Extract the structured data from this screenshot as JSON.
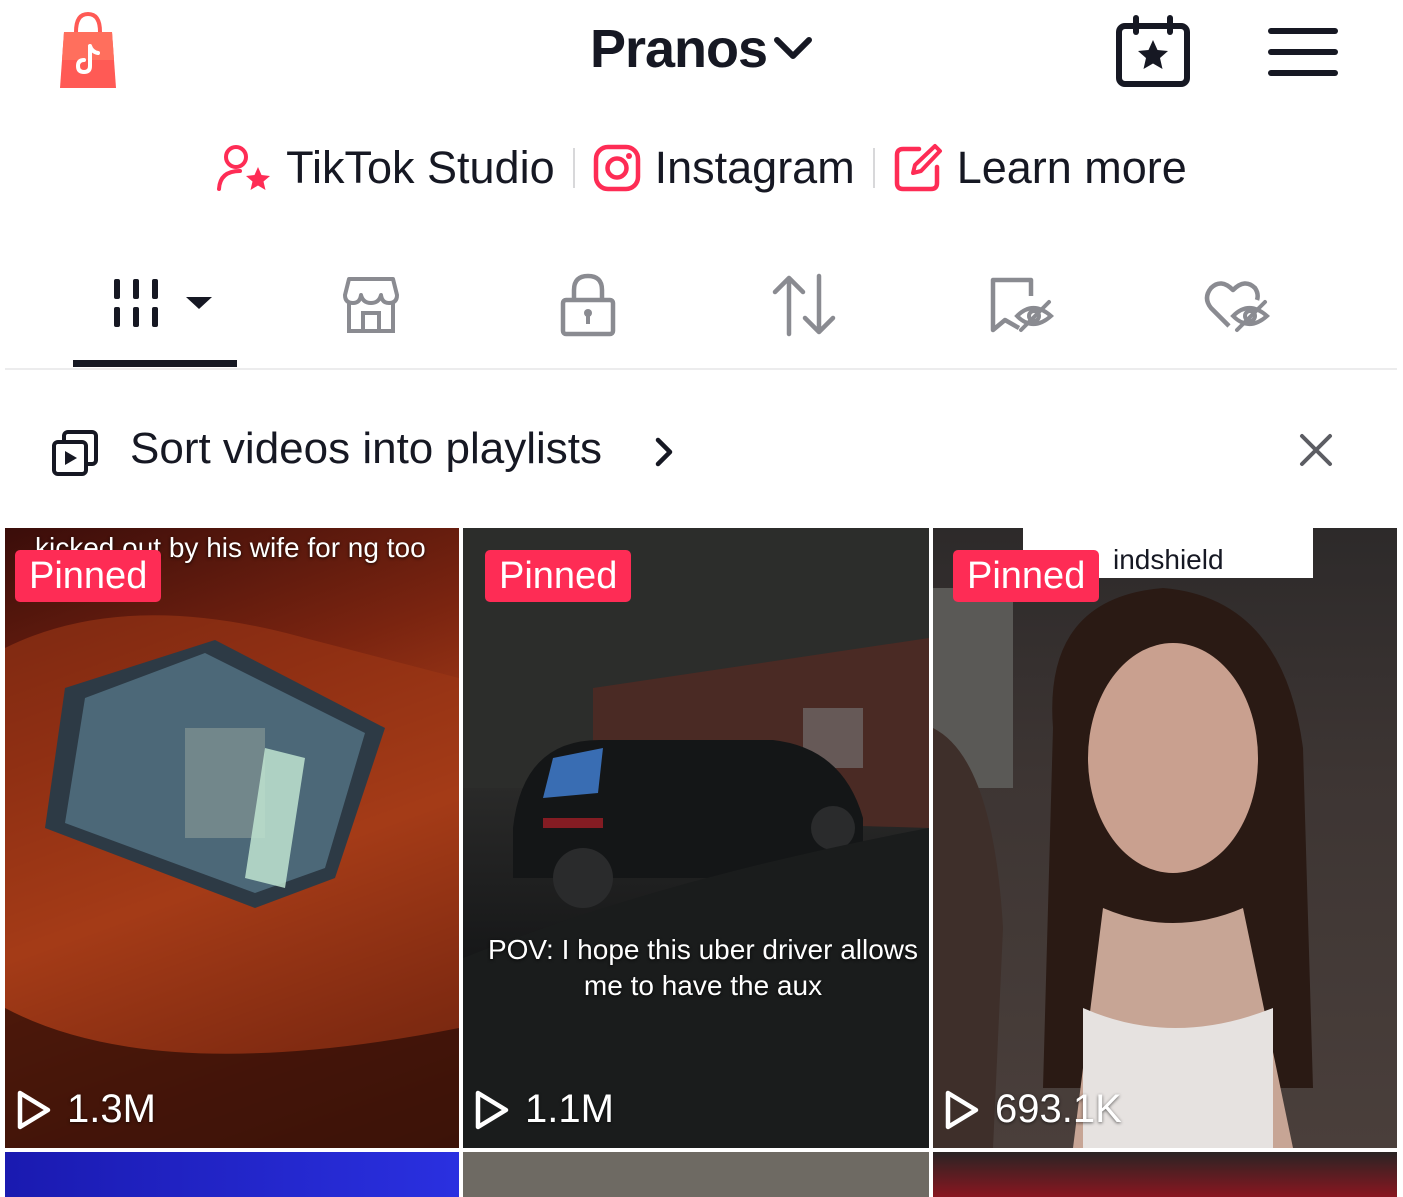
{
  "header": {
    "username": "Pranos",
    "shop_icon": "shopping-bag-icon",
    "calendar_icon": "calendar-star-icon",
    "menu_icon": "hamburger-menu-icon"
  },
  "links": [
    {
      "label": "TikTok Studio",
      "icon": "creator-star-icon"
    },
    {
      "label": "Instagram",
      "icon": "instagram-icon"
    },
    {
      "label": "Learn more",
      "icon": "edit-icon"
    }
  ],
  "tabs": [
    {
      "name": "videos",
      "icon": "grid-icon",
      "active": true
    },
    {
      "name": "shop",
      "icon": "storefront-icon",
      "active": false
    },
    {
      "name": "private",
      "icon": "lock-icon",
      "active": false
    },
    {
      "name": "reposts",
      "icon": "repost-icon",
      "active": false
    },
    {
      "name": "favorites",
      "icon": "bookmark-hidden-icon",
      "active": false
    },
    {
      "name": "liked",
      "icon": "heart-hidden-icon",
      "active": false
    }
  ],
  "banner": {
    "text": "Sort videos into playlists",
    "icon": "playlist-icon"
  },
  "videos": [
    {
      "pinned_label": "Pinned",
      "views": "1.3M",
      "caption": "kicked out by his wife for ng too much"
    },
    {
      "pinned_label": "Pinned",
      "views": "1.1M",
      "caption": "POV: I hope this uber driver allows me to have the aux"
    },
    {
      "pinned_label": "Pinned",
      "views": "693.1K",
      "caption": "indshield"
    }
  ],
  "colors": {
    "accent": "#fe2c55",
    "text": "#161823"
  }
}
